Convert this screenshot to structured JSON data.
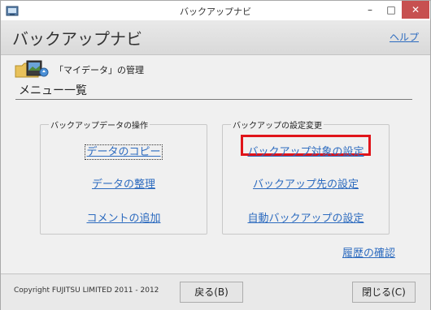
{
  "window": {
    "title": "バックアップナビ",
    "controls": {
      "minimize": "–",
      "maximize": "□",
      "close": "✕"
    }
  },
  "header": {
    "title": "バックアップナビ",
    "help_link": "ヘルプ"
  },
  "mydata": {
    "label": "「マイデータ」の管理"
  },
  "menu": {
    "title": "メニュー一覧"
  },
  "groups": {
    "data_ops": {
      "label": "バックアップデータの操作",
      "links": [
        "データのコピー",
        "データの整理",
        "コメントの追加"
      ]
    },
    "settings": {
      "label": "バックアップの設定変更",
      "links": [
        "バックアップ対象の設定",
        "バックアップ先の設定",
        "自動バックアップの設定"
      ]
    }
  },
  "history_link": "履歴の確認",
  "footer": {
    "copyright": "Copyright FUJITSU LIMITED 2011 - 2012",
    "back_button": "戻る(B)",
    "close_button": "閉じる(C)"
  },
  "colors": {
    "link": "#2d6bbf",
    "highlight": "#e0141a",
    "close_button_bg": "#c75050"
  },
  "icons": [
    "app-icon",
    "mydata-folder-icon"
  ]
}
